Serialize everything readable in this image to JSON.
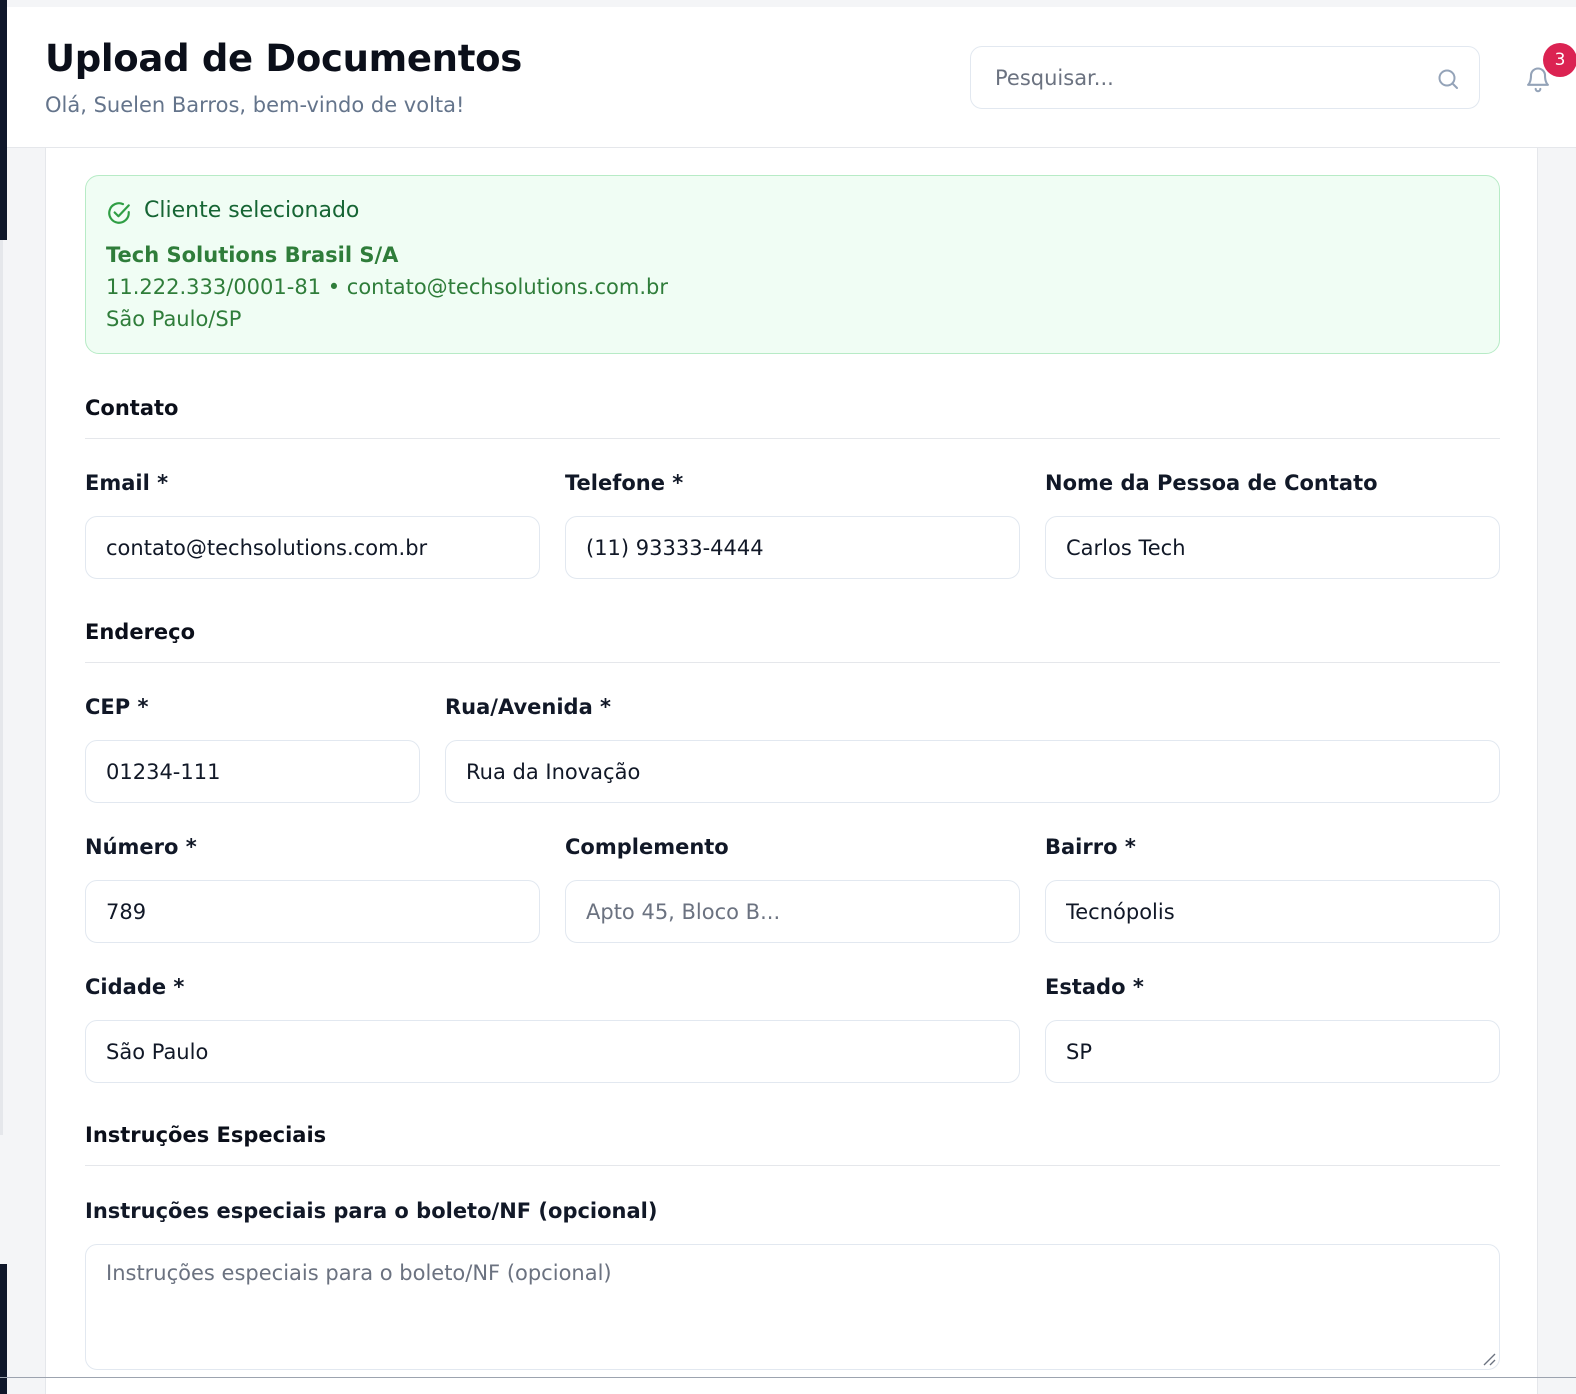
{
  "header": {
    "title": "Upload de Documentos",
    "subtitle": "Olá, Suelen Barros, bem-vindo de volta!",
    "search_placeholder": "Pesquisar...",
    "notification_count": "3"
  },
  "client": {
    "heading": "Cliente selecionado",
    "name": "Tech Solutions Brasil S/A",
    "info": "11.222.333/0001-81 • contato@techsolutions.com.br",
    "city": "São Paulo/SP"
  },
  "contact": {
    "section_title": "Contato",
    "email_label": "Email *",
    "email_value": "contato@techsolutions.com.br",
    "phone_label": "Telefone *",
    "phone_value": "(11) 93333-4444",
    "person_label": "Nome da Pessoa de Contato",
    "person_value": "Carlos Tech"
  },
  "address": {
    "section_title": "Endereço",
    "cep_label": "CEP *",
    "cep_value": "01234-111",
    "street_label": "Rua/Avenida *",
    "street_value": "Rua da Inovação",
    "number_label": "Número *",
    "number_value": "789",
    "complement_label": "Complemento",
    "complement_placeholder": "Apto 45, Bloco B...",
    "district_label": "Bairro *",
    "district_value": "Tecnópolis",
    "city_label": "Cidade *",
    "city_value": "São Paulo",
    "state_label": "Estado *",
    "state_value": "SP"
  },
  "instructions": {
    "section_title": "Instruções Especiais",
    "label": "Instruções especiais para o boleto/NF (opcional)",
    "placeholder": "Instruções especiais para o boleto/NF (opcional)"
  },
  "colors": {
    "accent_green": "#2f7d3a",
    "badge_red": "#db2352",
    "sidebar_dark": "#0f172a"
  }
}
